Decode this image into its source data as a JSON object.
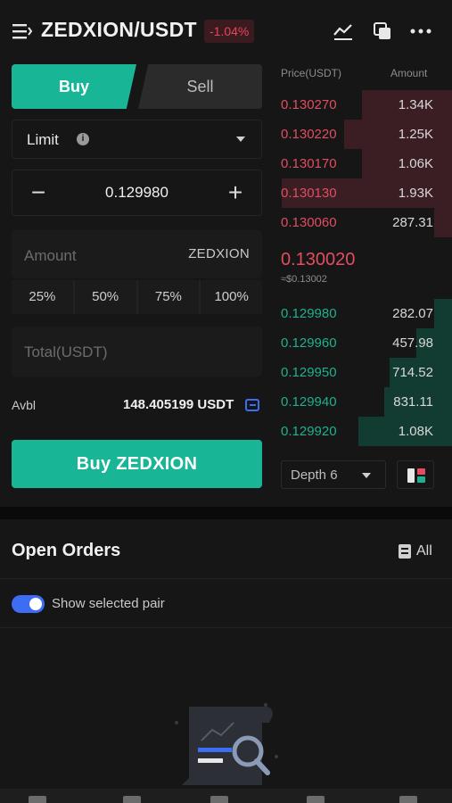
{
  "header": {
    "pair": "ZEDXION/USDT",
    "change": "-1.04%",
    "icons": [
      "menu-icon",
      "chart-icon",
      "copy-icon",
      "more-icon"
    ]
  },
  "trade": {
    "buy_tab": "Buy",
    "sell_tab": "Sell",
    "order_type": "Limit",
    "price": "0.129980",
    "amount_placeholder": "Amount",
    "amount_unit": "ZEDXION",
    "percents": [
      "25%",
      "50%",
      "75%",
      "100%"
    ],
    "total_placeholder": "Total(USDT)",
    "avbl_label": "Avbl",
    "avbl_value": "148.405199 USDT",
    "buy_button": "Buy ZEDXION"
  },
  "orderbook": {
    "price_header": "Price(USDT)",
    "amount_header": "Amount",
    "asks": [
      {
        "price": "0.130270",
        "amount": "1.34K",
        "depth": 0.5
      },
      {
        "price": "0.130220",
        "amount": "1.25K",
        "depth": 0.6
      },
      {
        "price": "0.130170",
        "amount": "1.06K",
        "depth": 0.5
      },
      {
        "price": "0.130130",
        "amount": "1.93K",
        "depth": 0.95
      },
      {
        "price": "0.130060",
        "amount": "287.31",
        "depth": 0.1
      }
    ],
    "last_price": "0.130020",
    "last_price_usd": "≈$0.13002",
    "bids": [
      {
        "price": "0.129980",
        "amount": "282.07",
        "depth": 0.1
      },
      {
        "price": "0.129960",
        "amount": "457.98",
        "depth": 0.2
      },
      {
        "price": "0.129950",
        "amount": "714.52",
        "depth": 0.35
      },
      {
        "price": "0.129940",
        "amount": "831.11",
        "depth": 0.38
      },
      {
        "price": "0.129920",
        "amount": "1.08K",
        "depth": 0.52
      }
    ],
    "depth_label": "Depth 6"
  },
  "orders": {
    "title": "Open Orders",
    "all_label": "All",
    "show_selected_label": "Show selected pair",
    "show_selected_on": true
  },
  "colors": {
    "accent_green": "#18b596",
    "ask_red": "#e24d61",
    "bid_green": "#1fb08f",
    "toggle_blue": "#3d6df2"
  }
}
